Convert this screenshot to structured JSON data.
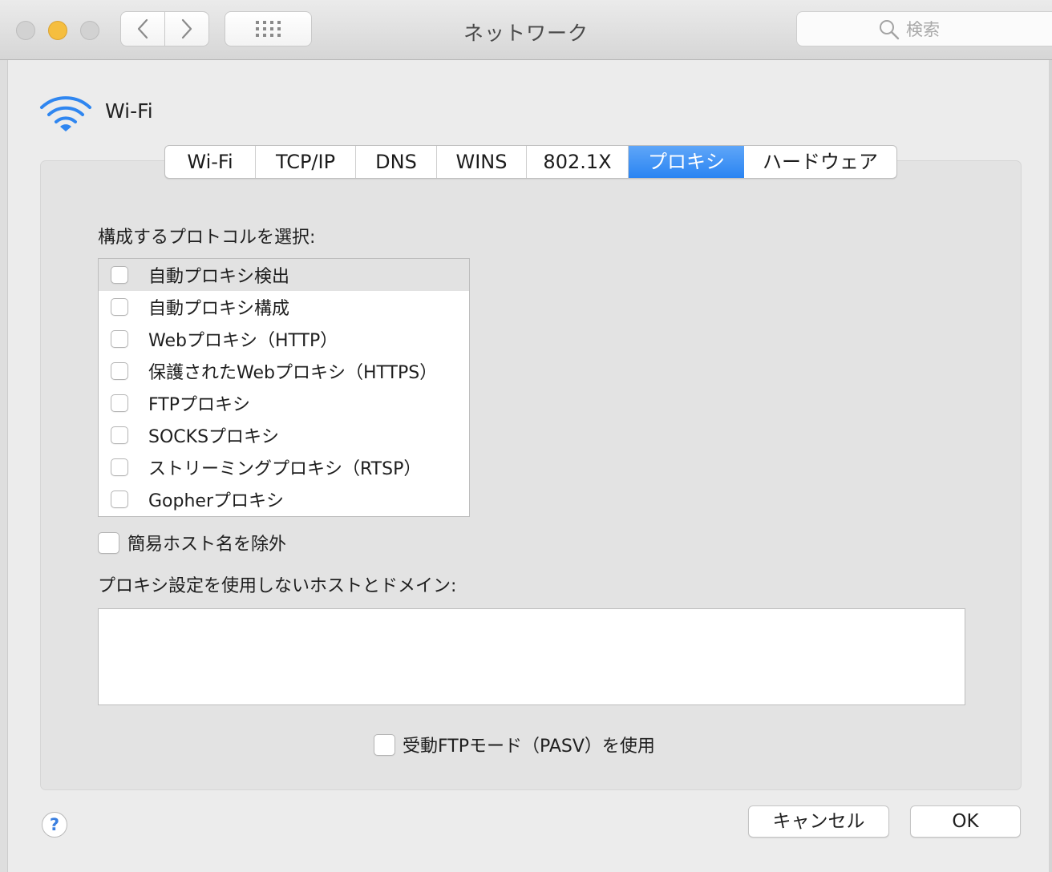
{
  "window": {
    "title": "ネットワーク"
  },
  "search": {
    "placeholder": "検索"
  },
  "service": {
    "name": "Wi-Fi"
  },
  "tabs": [
    {
      "label": "Wi-Fi",
      "active": false
    },
    {
      "label": "TCP/IP",
      "active": false
    },
    {
      "label": "DNS",
      "active": false
    },
    {
      "label": "WINS",
      "active": false
    },
    {
      "label": "802.1X",
      "active": false
    },
    {
      "label": "プロキシ",
      "active": true
    },
    {
      "label": "ハードウェア",
      "active": false
    }
  ],
  "protocols": {
    "heading": "構成するプロトコルを選択:",
    "items": [
      {
        "label": "自動プロキシ検出",
        "checked": false,
        "selected": true
      },
      {
        "label": "自動プロキシ構成",
        "checked": false,
        "selected": false
      },
      {
        "label": "Webプロキシ（HTTP）",
        "checked": false,
        "selected": false
      },
      {
        "label": "保護されたWebプロキシ（HTTPS）",
        "checked": false,
        "selected": false
      },
      {
        "label": "FTPプロキシ",
        "checked": false,
        "selected": false
      },
      {
        "label": "SOCKSプロキシ",
        "checked": false,
        "selected": false
      },
      {
        "label": "ストリーミングプロキシ（RTSP）",
        "checked": false,
        "selected": false
      },
      {
        "label": "Gopherプロキシ",
        "checked": false,
        "selected": false
      }
    ]
  },
  "exclude_simple": {
    "label": "簡易ホスト名を除外",
    "checked": false
  },
  "bypass": {
    "heading": "プロキシ設定を使用しないホストとドメイン:",
    "value": ""
  },
  "pasv": {
    "label": "受動FTPモード（PASV）を使用",
    "checked": false
  },
  "buttons": {
    "cancel": "キャンセル",
    "ok": "OK",
    "help": "?"
  },
  "colors": {
    "accent": "#2a84f2",
    "minimize": "#f5be3f"
  }
}
